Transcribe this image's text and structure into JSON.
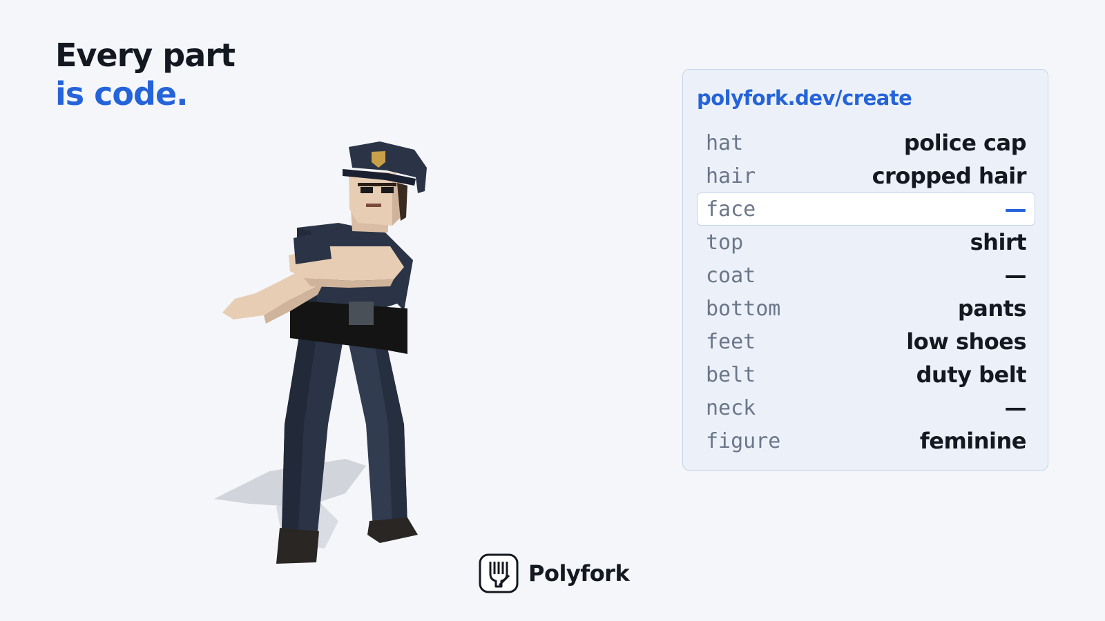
{
  "headline": {
    "line1": "Every part",
    "line2": "is code."
  },
  "panel": {
    "url": "polyfork.dev/create",
    "rows": [
      {
        "key": "hat",
        "value": "police cap"
      },
      {
        "key": "hair",
        "value": "cropped hair"
      },
      {
        "key": "face",
        "value": "—",
        "selected": true
      },
      {
        "key": "top",
        "value": "shirt"
      },
      {
        "key": "coat",
        "value": "—"
      },
      {
        "key": "bottom",
        "value": "pants"
      },
      {
        "key": "feet",
        "value": "low shoes"
      },
      {
        "key": "belt",
        "value": "duty belt"
      },
      {
        "key": "neck",
        "value": "—"
      },
      {
        "key": "figure",
        "value": "feminine"
      }
    ]
  },
  "brand": {
    "name": "Polyfork",
    "icon": "fork-icon"
  },
  "colors": {
    "accent": "#2563d9",
    "text": "#141820",
    "muted": "#6b7689",
    "panel_bg": "#ecf1f9",
    "panel_border": "#c4d3ea",
    "uniform": "#2b3446"
  }
}
